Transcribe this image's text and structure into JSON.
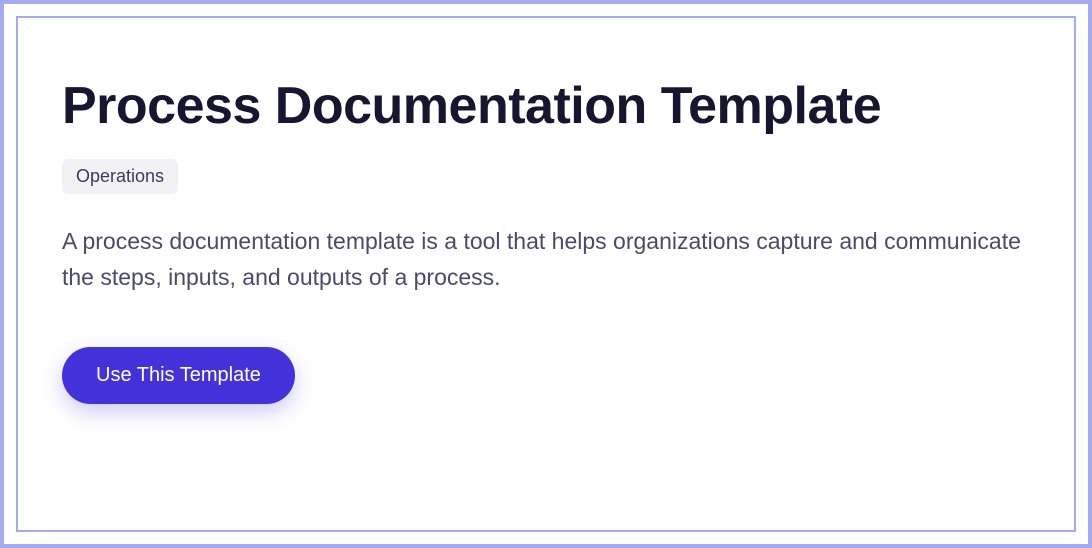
{
  "header": {
    "title": "Process Documentation Template"
  },
  "tag": {
    "label": "Operations"
  },
  "description": {
    "text": "A process documentation template is a tool that helps organizations capture and communicate the steps, inputs, and outputs of a process."
  },
  "cta": {
    "label": "Use This Template"
  }
}
